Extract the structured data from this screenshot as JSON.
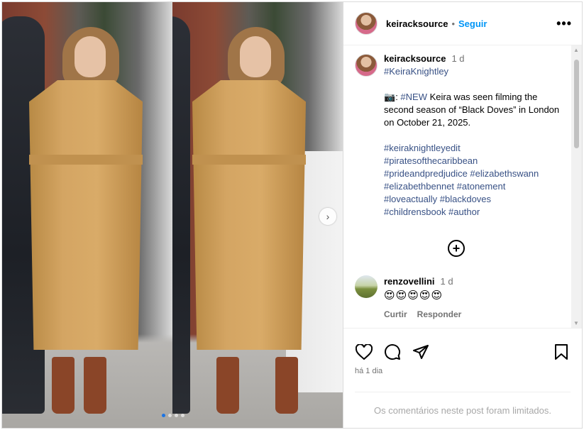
{
  "post": {
    "username": "keiracksource",
    "follow_label": "Seguir",
    "separator": "•"
  },
  "caption": {
    "username": "keiracksource",
    "time": "1 d",
    "line1": "#KeiraKnightley",
    "camera": "📷",
    "new_tag": "#NEW",
    "text": " Keira was seen filming the second season of “Black Doves” in London on October 21, 2025.",
    "tags": [
      "#keiraknightleyedit",
      "#piratesofthecaribbean",
      "#prideandpredjudice #elizabethswann",
      "#elizabethbennet #atonement",
      "#loveactually #blackdoves",
      "#childrensbook #author"
    ]
  },
  "comment": {
    "username": "renzovellini",
    "time": "1 d",
    "emojis": "😍😍😍😍😍",
    "like_label": "Curtir",
    "reply_label": "Responder"
  },
  "footer": {
    "posted": "há 1 dia",
    "limited": "Os comentários neste post foram limitados."
  },
  "icons": [
    "heart-icon",
    "comment-icon",
    "share-icon",
    "bookmark-icon",
    "more-icon",
    "add-circle-icon",
    "chevron-right-icon"
  ],
  "colors": {
    "follow": "#0095f6",
    "hashtag": "#385185",
    "muted": "#737373"
  },
  "carousel": {
    "slides": 4,
    "active": 1
  }
}
